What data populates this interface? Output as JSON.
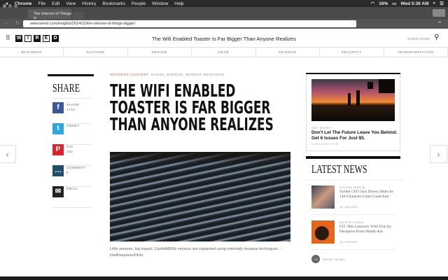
{
  "menubar": {
    "apple": "",
    "items": [
      "Chrome",
      "File",
      "Edit",
      "View",
      "History",
      "Bookmarks",
      "People",
      "Window",
      "Help"
    ],
    "battery": "16%",
    "clock": "Wed 5:36 AM"
  },
  "browser": {
    "tab_title": "The Internet of Things is",
    "url": "www.wired.com/insights/2014/11/the-internet-of-things-bigger/"
  },
  "header": {
    "logo": [
      "W",
      "I",
      "R",
      "E",
      "D"
    ],
    "title": "The Wifi Enabled Toaster Is Far Bigger Than Anyone Realizes",
    "subscribe": "SUBSCRIBE"
  },
  "nav": [
    "BUSINESS",
    "CULTURE",
    "DESIGN",
    "GEAR",
    "SCIENCE",
    "SECURITY",
    "TRANSPORTATION"
  ],
  "share": {
    "title": "SHARE",
    "items": [
      {
        "label": "SHARE",
        "count": "1742",
        "color": "#3b5998",
        "glyph": "f"
      },
      {
        "label": "TWEET",
        "count": "",
        "color": "#2ca7e0",
        "glyph": "t"
      },
      {
        "label": "PIN",
        "count": "182",
        "color": "#d8242b",
        "glyph": "P"
      },
      {
        "label": "COMMENT",
        "count": "0",
        "color": "#1f4e6b",
        "glyph": "…"
      },
      {
        "label": "EMAIL",
        "count": "",
        "color": "#222",
        "glyph": "✉"
      }
    ]
  },
  "article": {
    "kicker": "SPONSOR CONTENT",
    "author": "DANIEL BURRUS, BURRUS RESEARCH",
    "title": "THE WIFI ENABLED TOASTER IS FAR BIGGER THAN ANYONE REALIZES",
    "caption": "Little sensors, big impact: CardioMEMs sensors are implanted using minimally invasive techniques.",
    "credit": "intelfreepress/Flickr"
  },
  "promo": {
    "kicker": "GET WIRED",
    "text": "Don't Let The Future Leave You Behind. Get 6 Issues For Just $5.",
    "sub": "SUBSCRIBE NOW"
  },
  "latest": {
    "title": "LATEST NEWS",
    "items": [
      {
        "category": "SOCIAL MEDIA",
        "headline": "Twitter CEO Jack Dorsey Hints Its 140-Character Limit Could End",
        "time": "12 HOURS"
      },
      {
        "category": "ADVERTISING",
        "headline": "FTC Hits Lumosity With Fine for Deceptive Brain Health Ads",
        "time": "12 HOURS"
      }
    ],
    "more": "MORE NEWS"
  }
}
